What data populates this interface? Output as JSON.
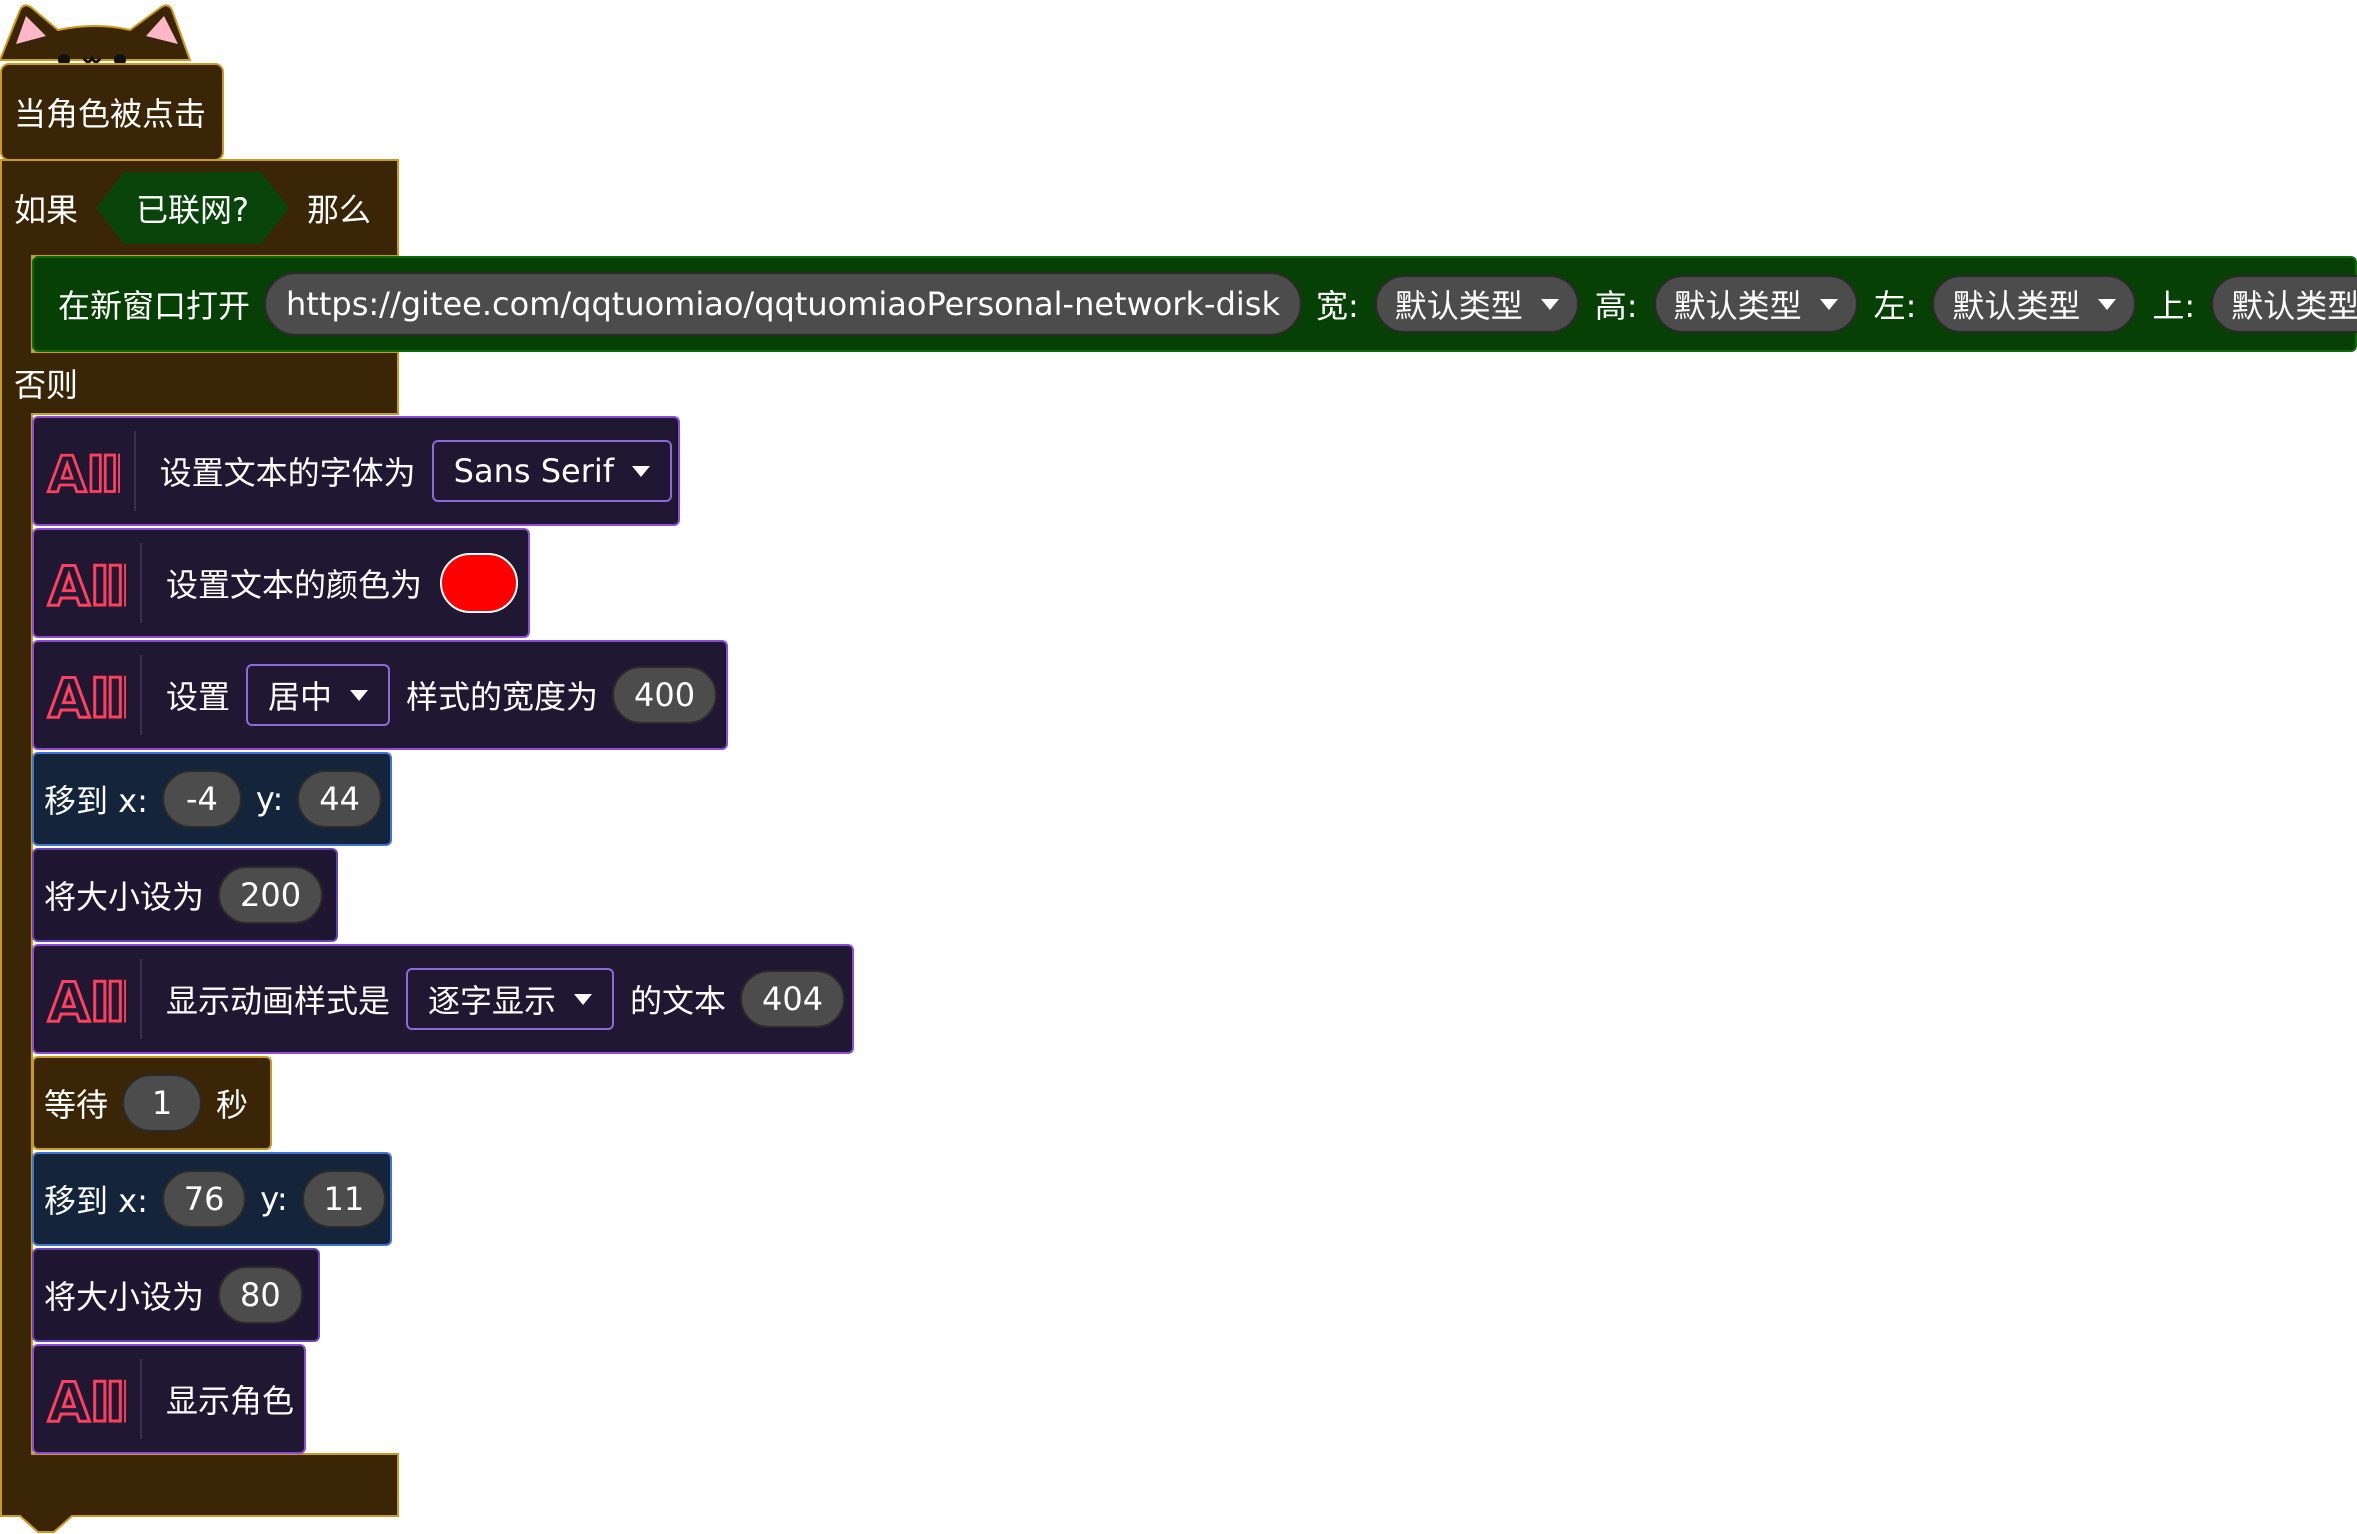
{
  "hat": {
    "label": "当角色被点击"
  },
  "if_block": {
    "if_label": "如果",
    "condition": "已联网?",
    "then_label": "那么",
    "else_label": "否则"
  },
  "open_window": {
    "label": "在新窗口打开",
    "url": "https://gitee.com/qqtuomiao/qqtuomiaoPersonal-network-disk",
    "width_label": "宽:",
    "width_value": "默认类型",
    "height_label": "高:",
    "height_value": "默认类型",
    "left_label": "左:",
    "left_value": "默认类型",
    "top_label": "上:",
    "top_value": "默认类型"
  },
  "set_font": {
    "label": "设置文本的字体为",
    "value": "Sans Serif"
  },
  "set_color": {
    "label": "设置文本的颜色为",
    "color": "#ff0000"
  },
  "set_align": {
    "prefix": "设置",
    "value": "居中",
    "suffix": "样式的宽度为",
    "width": "400"
  },
  "move1": {
    "label": "移到 x:",
    "x": "-4",
    "y_label": "y:",
    "y": "44"
  },
  "size1": {
    "label": "将大小设为",
    "value": "200"
  },
  "animate": {
    "label": "显示动画样式是",
    "style": "逐字显示",
    "suffix": "的文本",
    "value": "404"
  },
  "wait": {
    "label": "等待",
    "value": "1",
    "unit": "秒"
  },
  "move2": {
    "label": "移到 x:",
    "x": "76",
    "y_label": "y:",
    "y": "11"
  },
  "size2": {
    "label": "将大小设为",
    "value": "80"
  },
  "show": {
    "label": "显示角色"
  },
  "colors": {
    "control": "#3a2606",
    "control_border": "#cc9a1f",
    "network": "#064004",
    "motion": "#14243a",
    "looks": "#1f1732",
    "animated_text": "#201733"
  }
}
